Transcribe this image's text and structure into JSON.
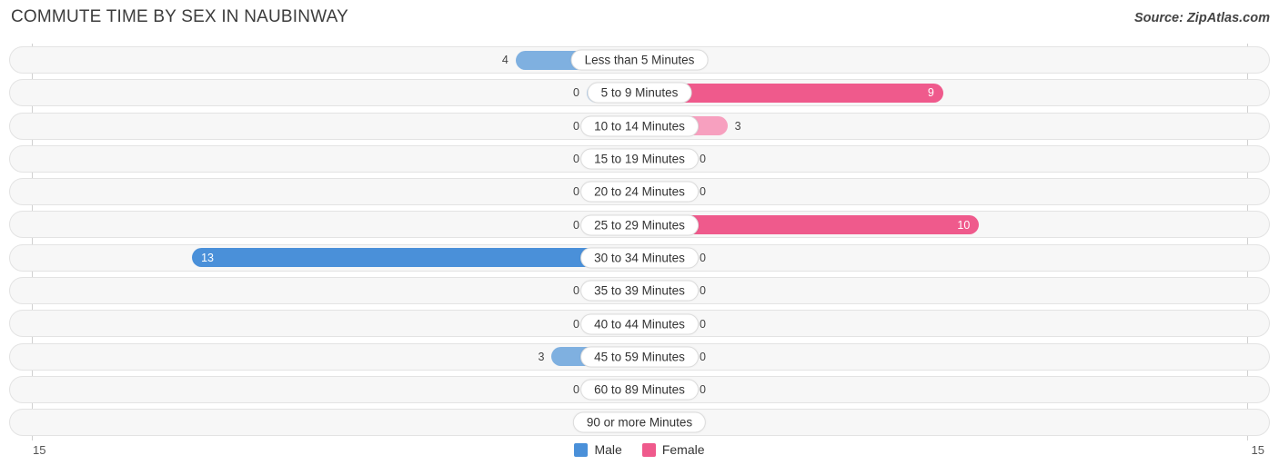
{
  "header": {
    "title": "COMMUTE TIME BY SEX IN NAUBINWAY",
    "source": "Source: ZipAtlas.com"
  },
  "legend": {
    "male": {
      "label": "Male",
      "color": "#4a90d9"
    },
    "female": {
      "label": "Female",
      "color": "#ef5a8c"
    }
  },
  "axis": {
    "left_tick": "15",
    "right_tick": "15"
  },
  "chart_data": {
    "type": "bar",
    "orientation": "horizontal-diverging",
    "title": "COMMUTE TIME BY SEX IN NAUBINWAY",
    "xlabel": "",
    "ylabel": "",
    "axis_max": 15,
    "grid": false,
    "legend_position": "bottom-center",
    "categories": [
      "Less than 5 Minutes",
      "5 to 9 Minutes",
      "10 to 14 Minutes",
      "15 to 19 Minutes",
      "20 to 24 Minutes",
      "25 to 29 Minutes",
      "30 to 34 Minutes",
      "35 to 39 Minutes",
      "40 to 44 Minutes",
      "45 to 59 Minutes",
      "60 to 89 Minutes",
      "90 or more Minutes"
    ],
    "series": [
      {
        "name": "Male",
        "color": "#4a90d9",
        "values": [
          4,
          0,
          0,
          0,
          0,
          0,
          13,
          0,
          0,
          3,
          0,
          0
        ]
      },
      {
        "name": "Female",
        "color": "#ef5a8c",
        "values": [
          0,
          9,
          3,
          0,
          0,
          10,
          0,
          0,
          0,
          0,
          0,
          0
        ]
      }
    ]
  },
  "rows": [
    {
      "label": "Less than 5 Minutes",
      "male": "4",
      "female": "0"
    },
    {
      "label": "5 to 9 Minutes",
      "male": "0",
      "female": "9"
    },
    {
      "label": "10 to 14 Minutes",
      "male": "0",
      "female": "3"
    },
    {
      "label": "15 to 19 Minutes",
      "male": "0",
      "female": "0"
    },
    {
      "label": "20 to 24 Minutes",
      "male": "0",
      "female": "0"
    },
    {
      "label": "25 to 29 Minutes",
      "male": "0",
      "female": "10"
    },
    {
      "label": "30 to 34 Minutes",
      "male": "13",
      "female": "0"
    },
    {
      "label": "35 to 39 Minutes",
      "male": "0",
      "female": "0"
    },
    {
      "label": "40 to 44 Minutes",
      "male": "0",
      "female": "0"
    },
    {
      "label": "45 to 59 Minutes",
      "male": "3",
      "female": "0"
    },
    {
      "label": "60 to 89 Minutes",
      "male": "0",
      "female": "0"
    },
    {
      "label": "90 or more Minutes",
      "male": "0",
      "female": "0"
    }
  ]
}
